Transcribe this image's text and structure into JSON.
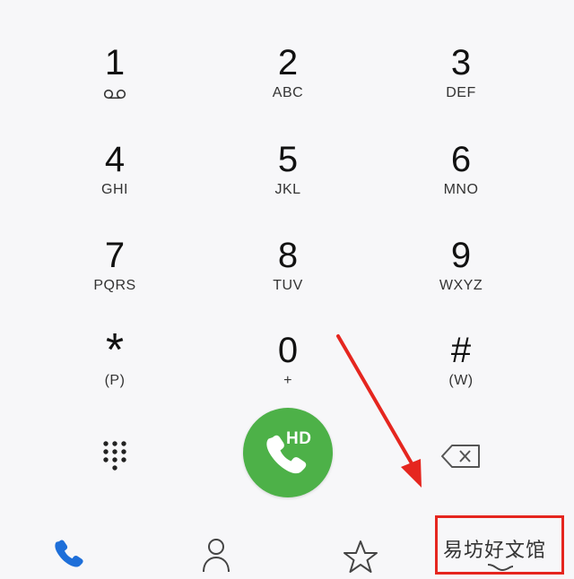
{
  "keypad": {
    "keys": [
      {
        "digit": "1",
        "letters": "",
        "icon": "voicemail-icon"
      },
      {
        "digit": "2",
        "letters": "ABC"
      },
      {
        "digit": "3",
        "letters": "DEF"
      },
      {
        "digit": "4",
        "letters": "GHI"
      },
      {
        "digit": "5",
        "letters": "JKL"
      },
      {
        "digit": "6",
        "letters": "MNO"
      },
      {
        "digit": "7",
        "letters": "PQRS"
      },
      {
        "digit": "8",
        "letters": "TUV"
      },
      {
        "digit": "9",
        "letters": "WXYZ"
      },
      {
        "digit": "*",
        "letters": "(P)"
      },
      {
        "digit": "0",
        "letters": "+"
      },
      {
        "digit": "#",
        "letters": "(W)"
      }
    ]
  },
  "actions": {
    "call_badge": "HD",
    "call_color": "#4db148",
    "dialpad_icon": "dialpad-grid-icon",
    "backspace_icon": "backspace-icon"
  },
  "bottom_nav": {
    "items": [
      {
        "icon": "phone-icon",
        "active": true,
        "color": "#1e6fd9"
      },
      {
        "icon": "contacts-icon",
        "active": false
      },
      {
        "icon": "star-icon",
        "active": false
      },
      {
        "icon": "call-log-icon",
        "active": false
      }
    ]
  },
  "annotation": {
    "highlight_color": "#e5261f",
    "watermark": "易坊好文馆"
  }
}
